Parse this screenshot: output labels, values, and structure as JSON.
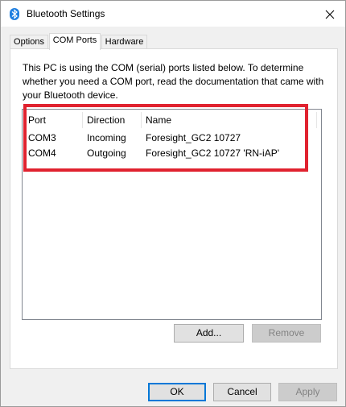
{
  "window": {
    "title": "Bluetooth Settings"
  },
  "tabs": [
    {
      "label": "Options"
    },
    {
      "label": "COM Ports"
    },
    {
      "label": "Hardware"
    }
  ],
  "panel": {
    "description": "This PC is using the COM (serial) ports listed below. To determine whether you need a COM port, read the documentation that came with your Bluetooth device."
  },
  "ports_table": {
    "columns": [
      "Port",
      "Direction",
      "Name"
    ],
    "rows": [
      {
        "port": "COM3",
        "direction": "Incoming",
        "name": "Foresight_GC2 10727"
      },
      {
        "port": "COM4",
        "direction": "Outgoing",
        "name": "Foresight_GC2 10727 'RN-iAP'"
      }
    ]
  },
  "buttons": {
    "add": "Add...",
    "remove": "Remove",
    "ok": "OK",
    "cancel": "Cancel",
    "apply": "Apply"
  },
  "colors": {
    "highlight": "#e0222f",
    "accent": "#0078d7",
    "bluetooth_icon": "#1f7fe0"
  },
  "icons": {
    "window_icon": "bluetooth-icon",
    "close": "close-icon"
  }
}
